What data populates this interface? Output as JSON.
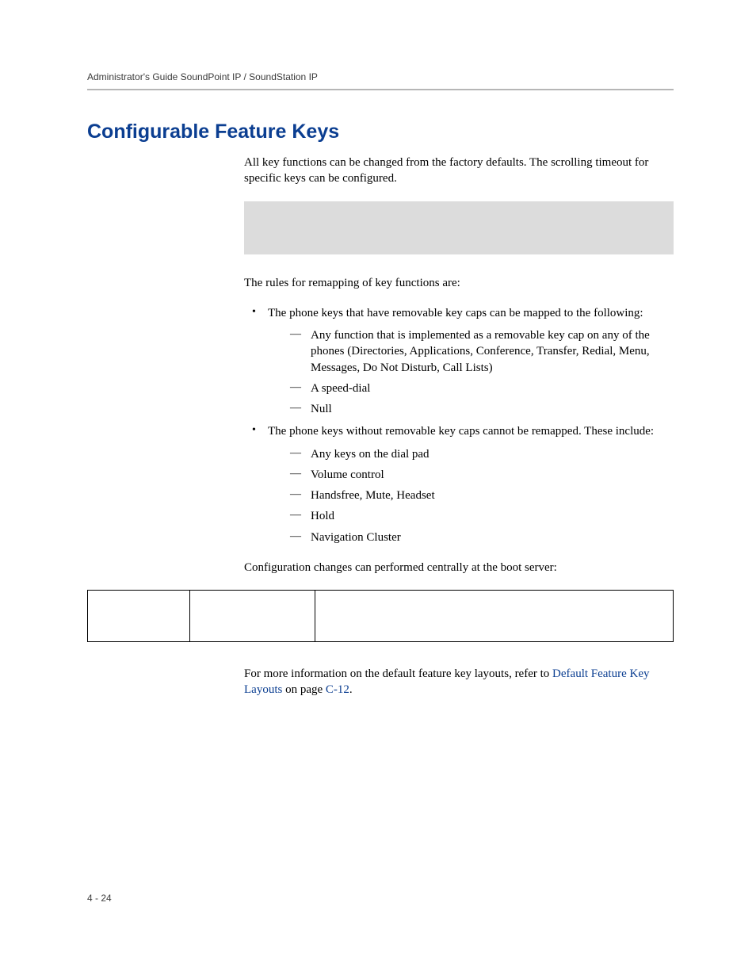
{
  "header": "Administrator's Guide SoundPoint IP / SoundStation IP",
  "sectionTitle": "Configurable Feature Keys",
  "intro": "All key functions can be changed from the factory defaults. The scrolling timeout for specific keys can be configured.",
  "rulesIntro": "The rules for remapping of key functions are:",
  "bullets": [
    {
      "text": "The phone keys that have removable key caps can be mapped to the following:",
      "sub": [
        "Any function that is implemented as a removable key cap on any of the phones (Directories, Applications, Conference, Transfer, Redial, Menu, Messages, Do Not Disturb, Call Lists)",
        "A speed-dial",
        "Null"
      ]
    },
    {
      "text": "The phone keys without removable key caps cannot be remapped. These include:",
      "sub": [
        "Any keys on the dial pad",
        "Volume control",
        "Handsfree, Mute, Headset",
        "Hold",
        "Navigation Cluster"
      ]
    }
  ],
  "configLine": "Configuration changes can performed centrally at the boot server:",
  "moreInfo": {
    "pre": "For more information on the default feature key layouts, refer to ",
    "link1": "Default Feature Key Layouts",
    "mid": " on page ",
    "link2": "C-12",
    "post": "."
  },
  "pageNum": "4 - 24"
}
